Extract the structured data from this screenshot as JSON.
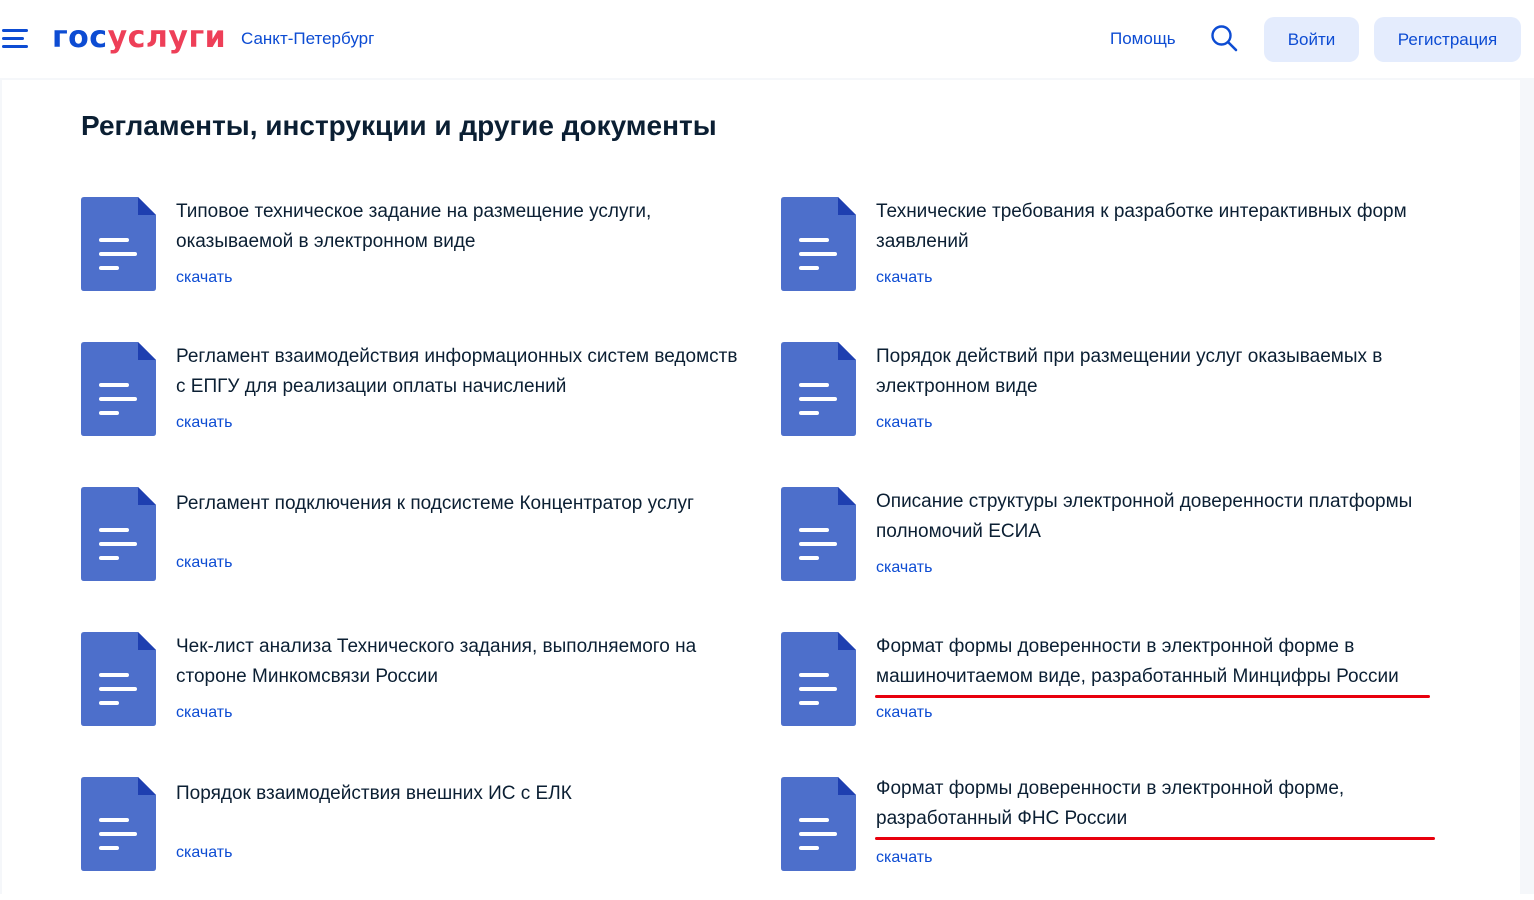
{
  "header": {
    "logo_part1": "гос",
    "logo_part2": "услуги",
    "city": "Санкт-Петербург",
    "help": "Помощь",
    "login": "Войти",
    "register": "Регистрация"
  },
  "main": {
    "title": "Регламенты, инструкции и другие документы",
    "download_label": "скачать",
    "documents": [
      {
        "title": "Типовое техническое задание на размещение услуги, оказываемой в электронном виде"
      },
      {
        "title": "Технические требования к разработке интерактивных форм заявлений"
      },
      {
        "title": "Регламент взаимодействия информационных систем ведомств с ЕПГУ для реализации оплаты начислений"
      },
      {
        "title": "Порядок действий при размещении услуг оказываемых в электронном виде"
      },
      {
        "title": "Регламент подключения к подсистеме Концентратор услуг"
      },
      {
        "title": "Описание структуры электронной доверенности платформы полномочий ЕСИА"
      },
      {
        "title": "Чек-лист анализа Технического задания, выполняемого на стороне Минкомсвязи России"
      },
      {
        "title": "Формат формы доверенности в электронной форме в машиночитаемом виде, разработанный Минцифры России",
        "highlighted": true
      },
      {
        "title": "Порядок взаимодействия внешних ИС с ЕЛК"
      },
      {
        "title": "Формат формы доверенности в электронной форме, разработанный ФНС России",
        "highlighted": true
      }
    ]
  },
  "colors": {
    "brand_blue": "#0d4cd3",
    "brand_red": "#ee3f58",
    "doc_icon": "#4d6fcb",
    "highlight_underline": "#e8000d"
  }
}
